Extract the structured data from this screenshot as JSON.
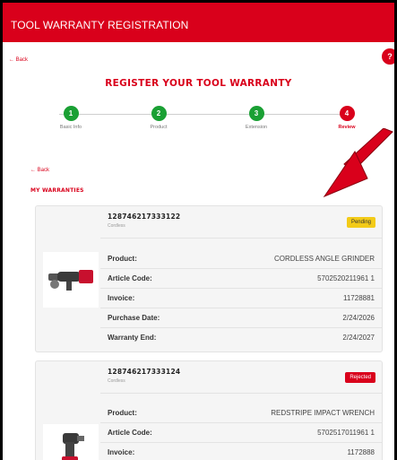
{
  "header": {
    "title": "TOOL WARRANTY REGISTRATION"
  },
  "nav": {
    "back_label": "← Back",
    "help_label": "?"
  },
  "page": {
    "title": "REGISTER YOUR TOOL WARRANTY"
  },
  "steps": [
    {
      "number": "1",
      "label": "Basic Info",
      "state": "done"
    },
    {
      "number": "2",
      "label": "Product",
      "state": "done"
    },
    {
      "number": "3",
      "label": "Extension",
      "state": "done"
    },
    {
      "number": "4",
      "label": "Review",
      "state": "active"
    }
  ],
  "section": {
    "back_label": "← Back",
    "title": "MY WARRANTIES"
  },
  "warranties": [
    {
      "id": "128746217333122",
      "category": "Cordless",
      "status": "Pending",
      "rows": [
        {
          "key": "Product:",
          "value": "CORDLESS ANGLE GRINDER"
        },
        {
          "key": "Article Code:",
          "value": "5702520211961 1"
        },
        {
          "key": "Invoice:",
          "value": "11728881"
        },
        {
          "key": "Purchase Date:",
          "value": "2/24/2026"
        },
        {
          "key": "Warranty End:",
          "value": "2/24/2027"
        }
      ]
    },
    {
      "id": "128746217333124",
      "category": "Cordless",
      "status": "Rejected",
      "rows": [
        {
          "key": "Product:",
          "value": "REDSTRIPE IMPACT WRENCH"
        },
        {
          "key": "Article Code:",
          "value": "5702517011961 1"
        },
        {
          "key": "Invoice:",
          "value": "1172888"
        }
      ]
    }
  ],
  "colors": {
    "brand_red": "#d9001b",
    "success_green": "#1aa034",
    "pending_yellow": "#f3cb18"
  }
}
